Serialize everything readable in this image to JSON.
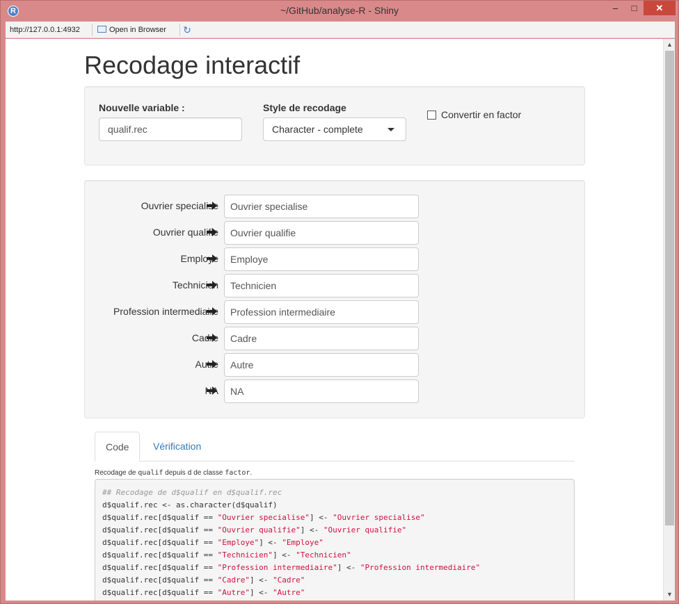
{
  "window": {
    "title": "~/GitHub/analyse-R - Shiny",
    "app_icon": "R",
    "buttons": {
      "minimize": "‒",
      "maximize": "□",
      "close": "✕"
    }
  },
  "toolbar": {
    "url": "http://127.0.0.1:4932",
    "open_in_browser": "Open in Browser",
    "refresh_icon": "refresh-icon"
  },
  "page": {
    "title": "Recodage interactif"
  },
  "settings": {
    "new_var_label": "Nouvelle variable :",
    "new_var_value": "qualif.rec",
    "style_label": "Style de recodage",
    "style_value": "Character - complete",
    "convert_label": "Convertir en factor",
    "convert_checked": false
  },
  "recode_rows": [
    {
      "label": "Ouvrier specialise",
      "value": "Ouvrier specialise"
    },
    {
      "label": "Ouvrier qualifie",
      "value": "Ouvrier qualifie"
    },
    {
      "label": "Employe",
      "value": "Employe"
    },
    {
      "label": "Technicien",
      "value": "Technicien"
    },
    {
      "label": "Profession intermediaire",
      "value": "Profession intermediaire"
    },
    {
      "label": "Cadre",
      "value": "Cadre"
    },
    {
      "label": "Autre",
      "value": "Autre"
    },
    {
      "label": "NA",
      "value": "NA"
    }
  ],
  "tabs": [
    {
      "label": "Code",
      "active": true
    },
    {
      "label": "Vérification",
      "active": false
    }
  ],
  "code_panel": {
    "desc_prefix": "Recodage de ",
    "desc_var": "qualif",
    "desc_mid": " depuis ",
    "desc_df": "d",
    "desc_mid2": " de classe ",
    "desc_class": "factor",
    "desc_suffix": ".",
    "comment": "## Recodage de d$qualif en d$qualif.rec",
    "line1_a": "d$qualif.rec <- ",
    "line1_fn": "as.character",
    "line1_b": "(d$qualif)",
    "assign_prefix": "d$qualif.rec[d$qualif == ",
    "assign_mid": "] <- "
  },
  "colors": {
    "link": "#337ab7",
    "string": "#d01040",
    "well_bg": "#f5f5f5",
    "window_frame": "#d9898a"
  }
}
